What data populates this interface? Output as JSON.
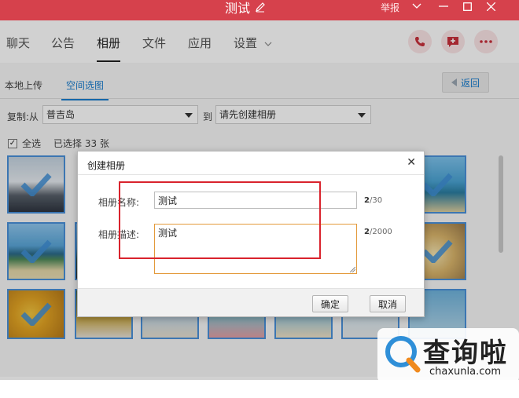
{
  "window": {
    "title": "测试",
    "report_label": "举报"
  },
  "nav": {
    "tabs": [
      "聊天",
      "公告",
      "相册",
      "文件",
      "应用",
      "设置"
    ],
    "active_tab": "相册"
  },
  "album": {
    "subtabs": [
      "本地上传",
      "空间选图"
    ],
    "active_subtab": "空间选图",
    "back_label": "返回",
    "copy_from_label": "复制:从",
    "source_album": "普吉岛",
    "to_label": "到",
    "target_album": "请先创建相册",
    "select_all_label": "全选",
    "selected_count_text": "已选择 33 张"
  },
  "dialog": {
    "title": "创建相册",
    "name_label": "相册名称:",
    "name_value": "测试",
    "name_count": "2",
    "name_max": "/30",
    "desc_label": "相册描述:",
    "desc_value": "测试",
    "desc_count": "2",
    "desc_max": "/2000",
    "confirm_label": "确定",
    "cancel_label": "取消"
  },
  "watermark": {
    "brand": "查询啦",
    "domain": "chaxunla.com"
  },
  "colors": {
    "titlebar": "#d6414c",
    "accent_blue": "#1a7ecf",
    "highlight_red": "#d9232d",
    "input_focus": "#e39a3b"
  }
}
